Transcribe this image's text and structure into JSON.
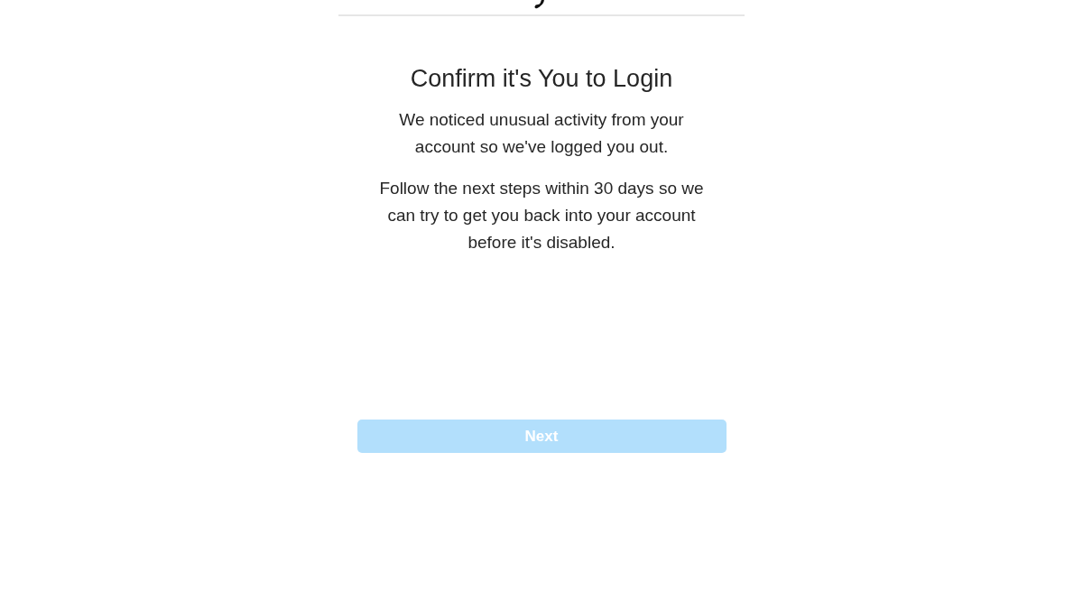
{
  "title": "Confirm it's You to Login",
  "paragraphs": [
    "We noticed unusual activity from your account so we've logged you out.",
    "Follow the next steps within 30 days so we can try to get you back into your account before it's disabled."
  ],
  "next_button": {
    "label": "Next",
    "disabled": true
  }
}
